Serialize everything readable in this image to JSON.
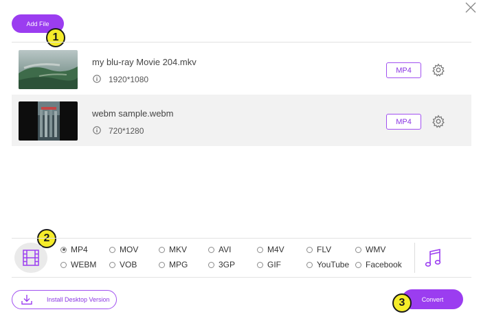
{
  "toolbar": {
    "add_file_label": "Add File"
  },
  "steps": {
    "one": "1",
    "two": "2",
    "three": "3"
  },
  "files": [
    {
      "name": "my blu-ray Movie 204.mkv",
      "resolution": "1920*1080",
      "format": "MP4"
    },
    {
      "name": "webm sample.webm",
      "resolution": "720*1280",
      "format": "MP4"
    }
  ],
  "formats": {
    "selected": "MP4",
    "row1": [
      "MP4",
      "MOV",
      "MKV",
      "AVI",
      "M4V",
      "FLV",
      "WMV"
    ],
    "row2": [
      "WEBM",
      "VOB",
      "MPG",
      "3GP",
      "GIF",
      "YouTube",
      "Facebook"
    ]
  },
  "footer": {
    "install_label": "Install Desktop Version",
    "convert_label": "Convert"
  },
  "colors": {
    "accent": "#9b3df0",
    "badge": "#f5ec2a"
  },
  "icons": [
    "close-icon",
    "info-icon",
    "gear-icon",
    "film-icon",
    "music-note-icon",
    "download-icon"
  ]
}
